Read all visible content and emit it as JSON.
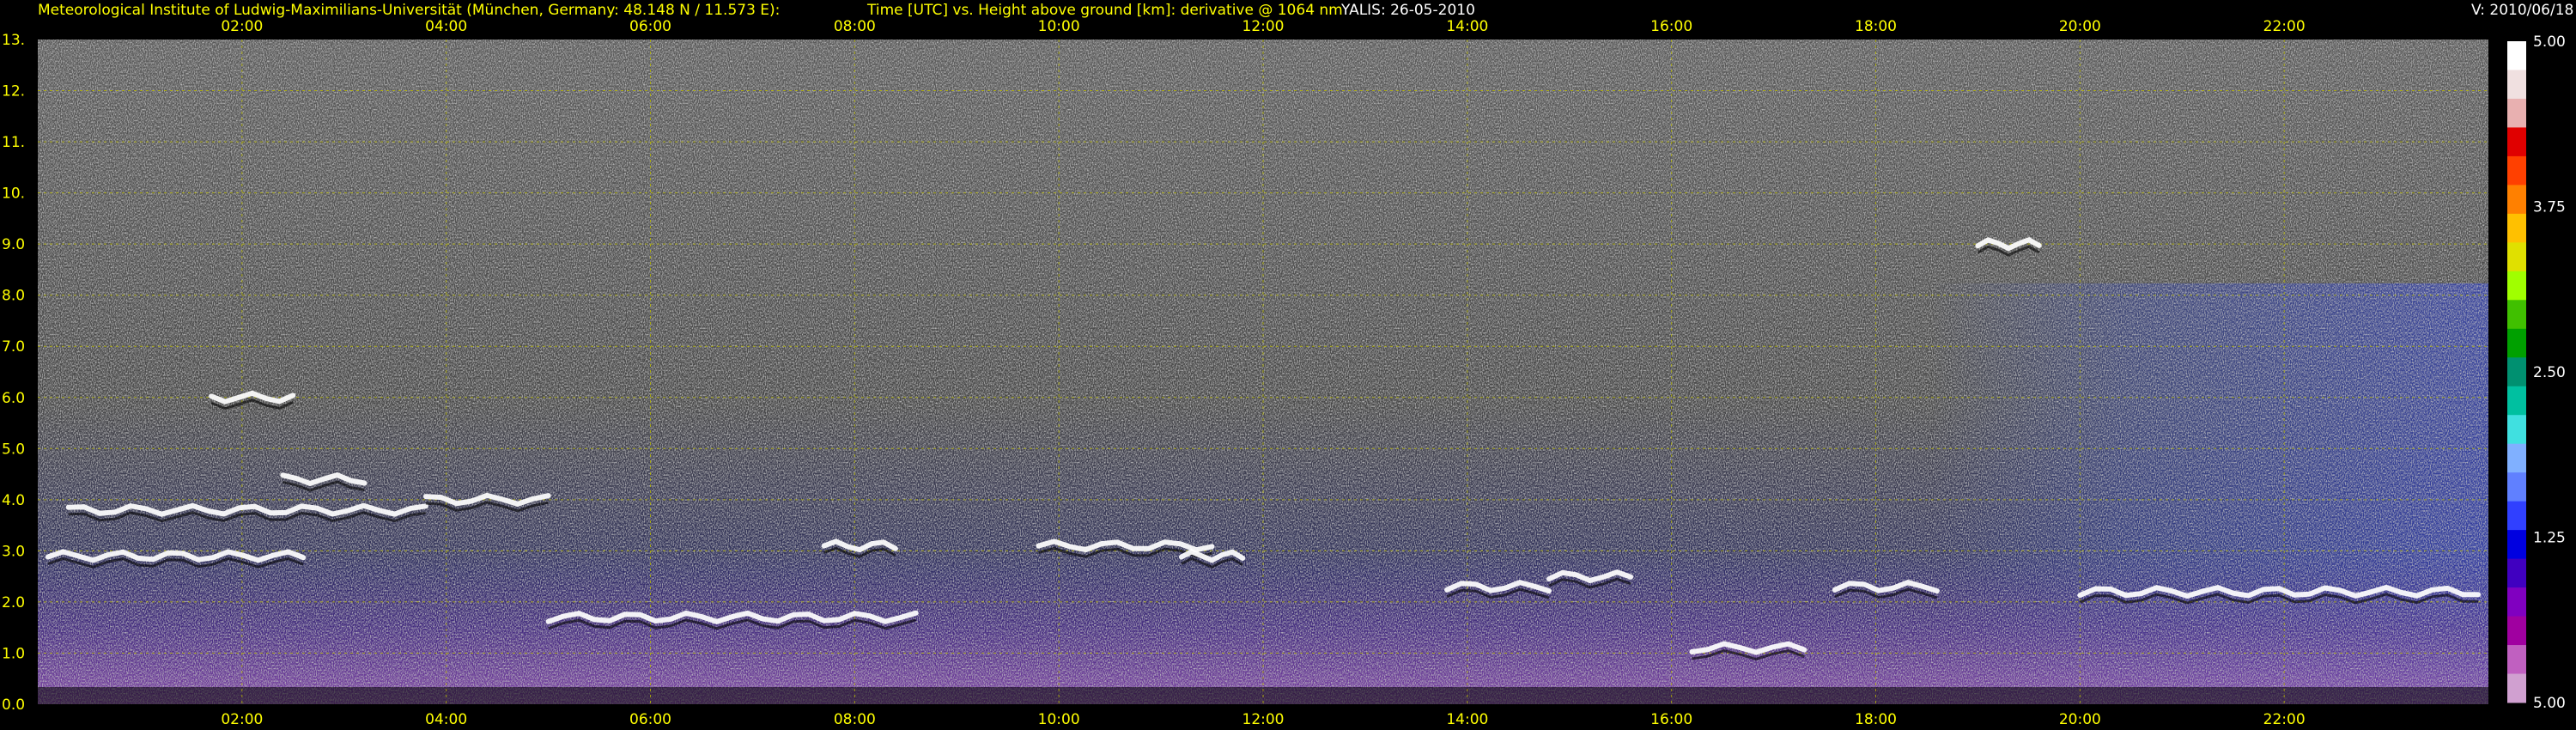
{
  "header": {
    "institute": "Meteorological Institute of Ludwig-Maximilians-Universität (München, Germany: 48.148 N / 11.573 E):",
    "plot_title": "Time [UTC] vs. Height above ground [km]: derivative @ 1064 nm",
    "instrument_date": "YALIS: 26-05-2010",
    "version": "V: 2010/06/18"
  },
  "chart_data": {
    "type": "heatmap",
    "title": "Time [UTC] vs. Height above ground [km]: derivative @ 1064 nm",
    "xlabel": "Time [UTC]",
    "ylabel": "Height above ground [km]",
    "x_ticks": [
      "02:00",
      "04:00",
      "06:00",
      "08:00",
      "10:00",
      "12:00",
      "14:00",
      "16:00",
      "18:00",
      "20:00",
      "22:00"
    ],
    "x_tick_hours": [
      2,
      4,
      6,
      8,
      10,
      12,
      14,
      16,
      18,
      20,
      22
    ],
    "xlim": [
      0,
      24
    ],
    "y_ticks": [
      "0.0",
      "1.0",
      "2.0",
      "3.0",
      "4.0",
      "5.0",
      "6.0",
      "7.0",
      "8.0",
      "9.0",
      "10.",
      "11.",
      "12.",
      "13."
    ],
    "ylim": [
      0,
      13
    ],
    "grid": true,
    "colorbar": {
      "tick_labels": [
        "5.00",
        "3.75",
        "2.50",
        "1.25",
        "5.00"
      ],
      "colors": [
        "#ffffff",
        "#f0e0e0",
        "#e8b0b0",
        "#e00000",
        "#ff4000",
        "#ff8000",
        "#ffc000",
        "#e0e000",
        "#a0ff00",
        "#40c000",
        "#00a000",
        "#009070",
        "#00c0a0",
        "#40e0e0",
        "#80b0ff",
        "#6080ff",
        "#3040ff",
        "#0000e0",
        "#4000c0",
        "#8000c0",
        "#a000a0",
        "#c060c0",
        "#d0a0d0"
      ]
    },
    "cloud_layers": [
      {
        "t": [
          0.1,
          2.6
        ],
        "h": 2.9
      },
      {
        "t": [
          0.3,
          3.8
        ],
        "h": 3.8
      },
      {
        "t": [
          1.7,
          2.5
        ],
        "h": 6.0
      },
      {
        "t": [
          2.4,
          3.2
        ],
        "h": 4.4
      },
      {
        "t": [
          3.8,
          5.0
        ],
        "h": 4.0
      },
      {
        "t": [
          5.0,
          8.6
        ],
        "h": 1.7
      },
      {
        "t": [
          7.7,
          8.4
        ],
        "h": 3.1
      },
      {
        "t": [
          9.8,
          11.5
        ],
        "h": 3.1
      },
      {
        "t": [
          11.2,
          11.8
        ],
        "h": 2.9
      },
      {
        "t": [
          13.8,
          14.8
        ],
        "h": 2.3
      },
      {
        "t": [
          14.8,
          15.6
        ],
        "h": 2.5
      },
      {
        "t": [
          16.2,
          17.3
        ],
        "h": 1.1
      },
      {
        "t": [
          17.6,
          18.6
        ],
        "h": 2.3
      },
      {
        "t": [
          19.0,
          19.6
        ],
        "h": 9.0
      },
      {
        "t": [
          20.0,
          23.9
        ],
        "h": 2.2
      }
    ]
  }
}
